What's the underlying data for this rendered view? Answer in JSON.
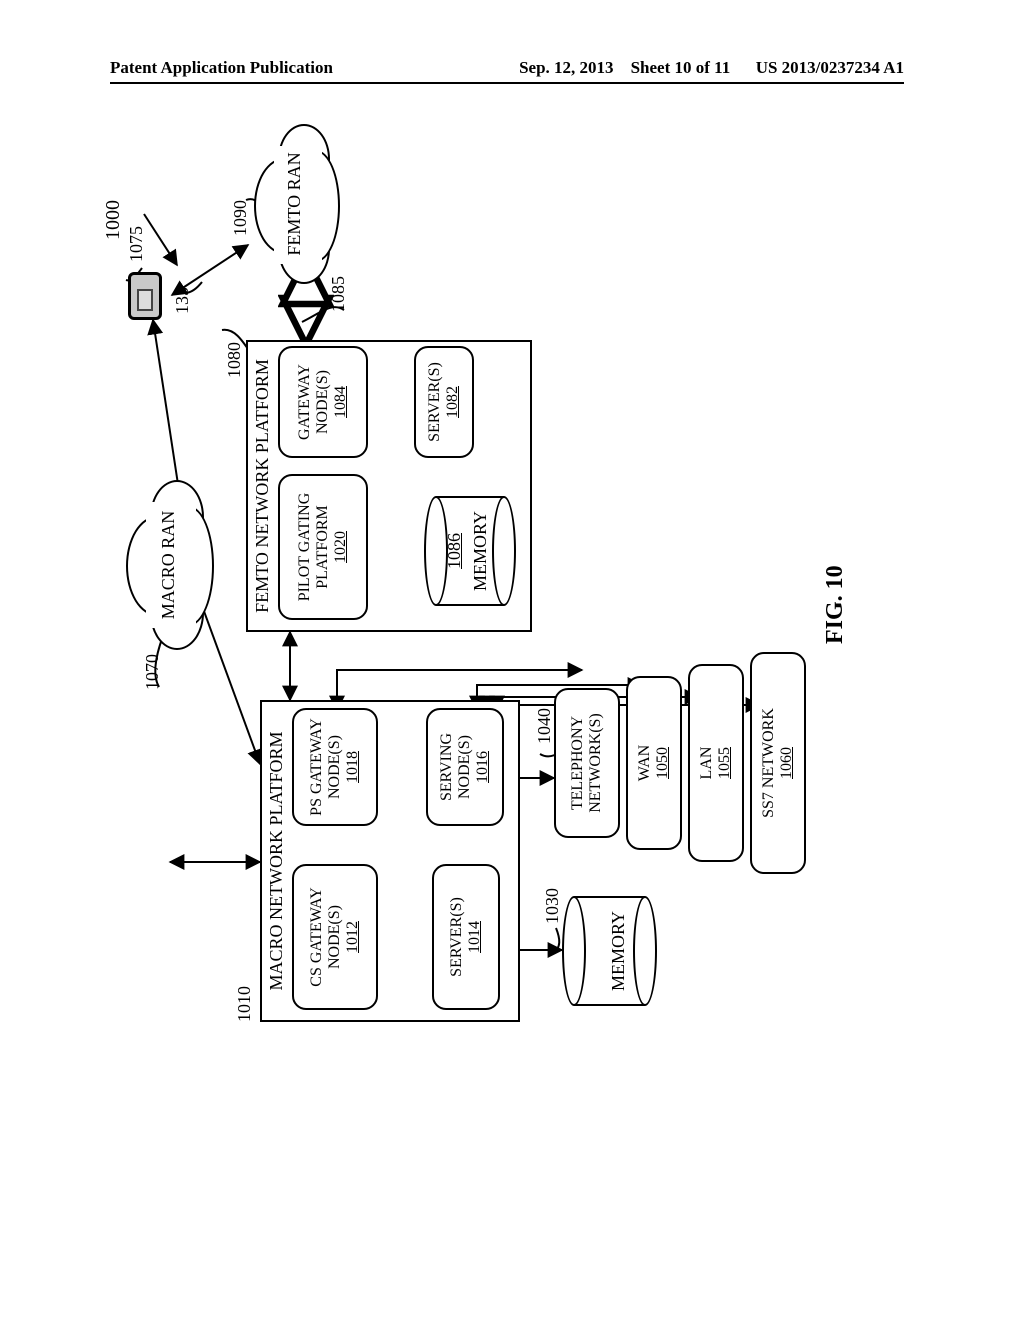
{
  "header": {
    "left": "Patent Application Publication",
    "date": "Sep. 12, 2013",
    "sheet": "Sheet 10 of 11",
    "pubno": "US 2013/0237234 A1"
  },
  "figure": {
    "number": "FIG. 10",
    "sysref": "1000"
  },
  "macro_platform": {
    "title": "MACRO NETWORK PLATFORM",
    "ref": "1010",
    "cs_gw": {
      "l1": "CS GATEWAY",
      "l2": "NODE(S)",
      "ref": "1012"
    },
    "ps_gw": {
      "l1": "PS GATEWAY",
      "l2": "NODE(S)",
      "ref": "1018"
    },
    "server": {
      "l1": "SERVER(S)",
      "ref": "1014"
    },
    "serving": {
      "l1": "SERVING",
      "l2": "NODE(S)",
      "ref": "1016"
    },
    "memory": {
      "label": "MEMORY",
      "ref": "1030"
    }
  },
  "networks": {
    "telephony": {
      "l1": "TELEPHONY",
      "l2": "NETWORK(S)",
      "ref": "1040"
    },
    "wan": {
      "l1": "WAN",
      "ref": "1050"
    },
    "lan": {
      "l1": "LAN",
      "ref": "1055"
    },
    "ss7": {
      "l1": "SS7 NETWORK",
      "ref": "1060"
    }
  },
  "femto_platform": {
    "title": "FEMTO NETWORK PLATFORM",
    "ref": "1080",
    "pilot": {
      "l1": "PILOT GATING",
      "l2": "PLATFORM",
      "ref": "1020"
    },
    "gw": {
      "l1": "GATEWAY",
      "l2": "NODE(S)",
      "ref": "1084"
    },
    "server": {
      "l1": "SERVER(S)",
      "ref": "1082"
    },
    "memory": {
      "label": "MEMORY",
      "ref": "1086"
    }
  },
  "clouds": {
    "macro": {
      "label": "MACRO RAN",
      "ref": "1070"
    },
    "femto": {
      "label": "FEMTO RAN",
      "ref": "1090"
    }
  },
  "links": {
    "femto_ran": "1085",
    "ue_femto": "135"
  },
  "ue": {
    "ref": "1075"
  }
}
